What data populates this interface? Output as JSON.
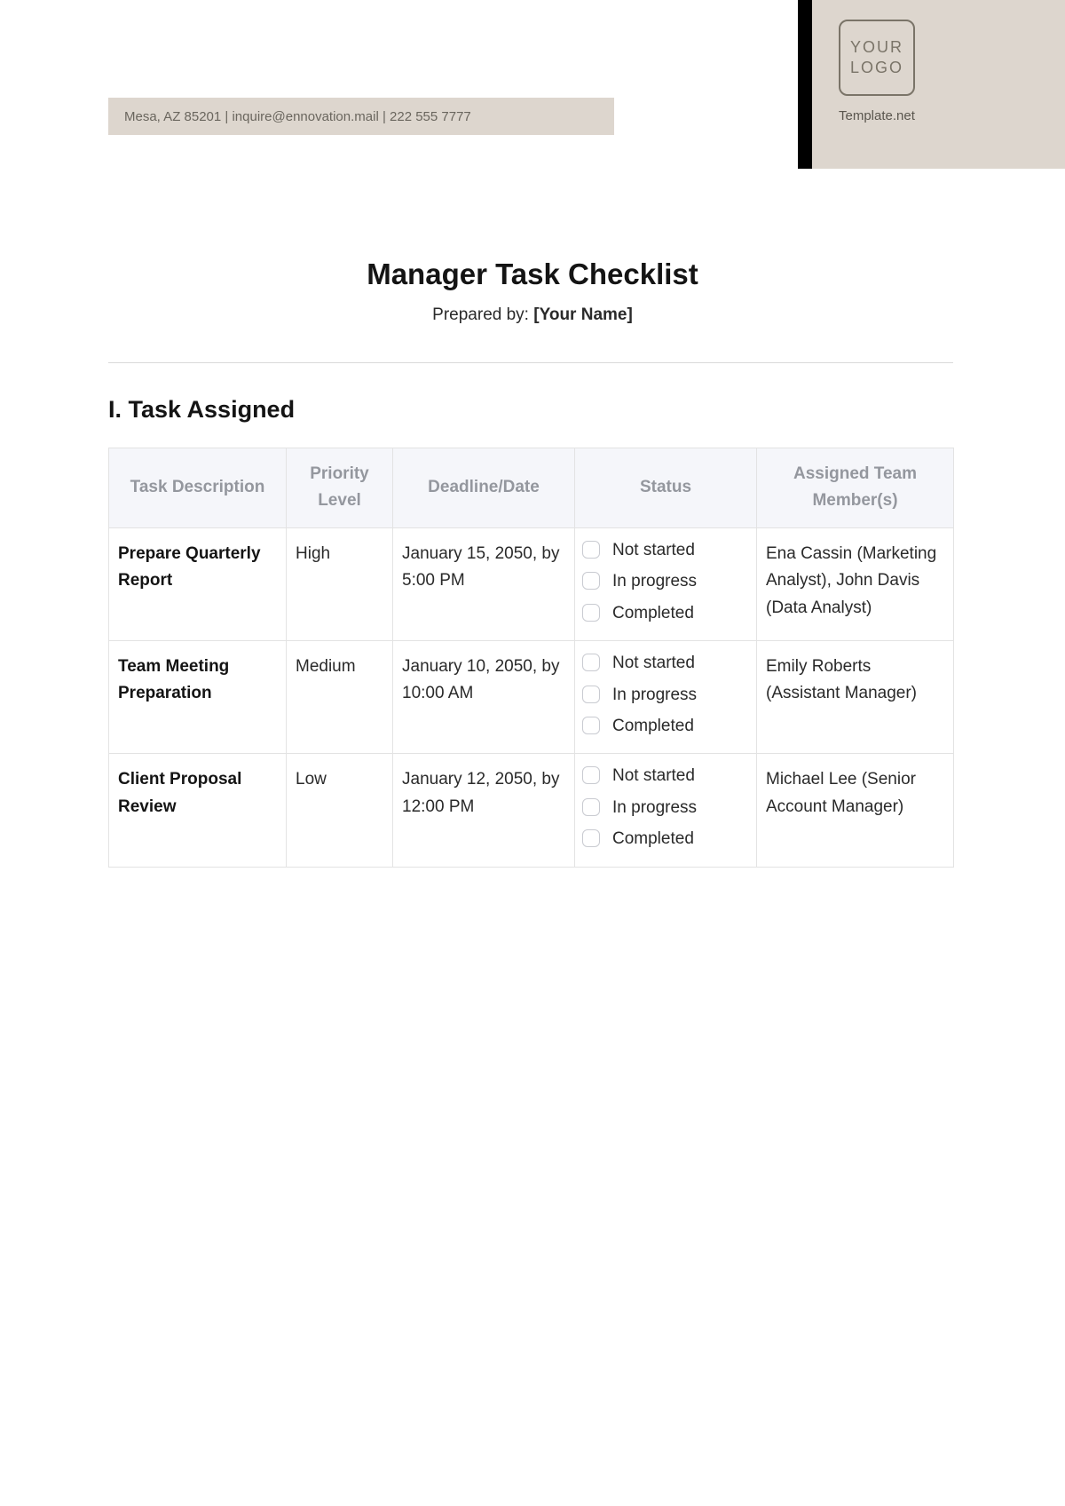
{
  "side": {
    "logo_line1": "YOUR",
    "logo_line2": "LOGO",
    "caption": "Template.net"
  },
  "topbar": {
    "contact": "Mesa, AZ 85201 | inquire@ennovation.mail | 222 555 7777"
  },
  "title": "Manager Task Checklist",
  "prepared_label": "Prepared by: ",
  "prepared_value": "[Your Name]",
  "section1_heading": "I. Task Assigned",
  "columns": {
    "c1": "Task Description",
    "c2": "Priority Level",
    "c3": "Deadline/Date",
    "c4": "Status",
    "c5": "Assigned Team Member(s)"
  },
  "status_options": {
    "s1": "Not started",
    "s2": "In progress",
    "s3": "Completed"
  },
  "rows": [
    {
      "desc": "Prepare Quarterly Report",
      "priority": "High",
      "deadline": "January 15, 2050, by 5:00 PM",
      "assigned": "Ena Cassin (Marketing Analyst), John Davis (Data Analyst)"
    },
    {
      "desc": "Team Meeting Preparation",
      "priority": "Medium",
      "deadline": "January 10, 2050, by 10:00 AM",
      "assigned": "Emily Roberts (Assistant Manager)"
    },
    {
      "desc": "Client Proposal Review",
      "priority": "Low",
      "deadline": "January 12, 2050, by 12:00 PM",
      "assigned": "Michael Lee (Senior Account Manager)"
    }
  ]
}
